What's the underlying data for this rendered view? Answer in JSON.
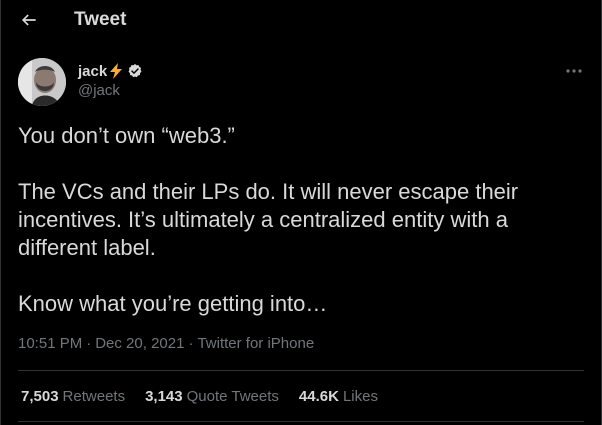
{
  "header": {
    "back_icon": "arrow-left-icon",
    "title": "Tweet"
  },
  "author": {
    "name": "jack",
    "emoji": "lightning-bolt",
    "verified": true,
    "handle": "@jack"
  },
  "tweet": {
    "paragraphs": [
      "You don’t own “web3.”",
      "The VCs and their LPs do. It will never escape their incentives. It’s ultimately a centralized entity with a different label.",
      "Know what you’re getting into…"
    ],
    "time": "10:51 PM",
    "date": "Dec 20, 2021",
    "source": "Twitter for iPhone"
  },
  "stats": {
    "retweets_count": "7,503",
    "retweets_label": "Retweets",
    "quotes_count": "3,143",
    "quotes_label": "Quote Tweets",
    "likes_count": "44.6K",
    "likes_label": "Likes"
  },
  "colors": {
    "background": "#000000",
    "text_primary": "#d9d9d9",
    "text_secondary": "#71767b",
    "divider": "#2f3336",
    "bolt": "#ffac33"
  }
}
